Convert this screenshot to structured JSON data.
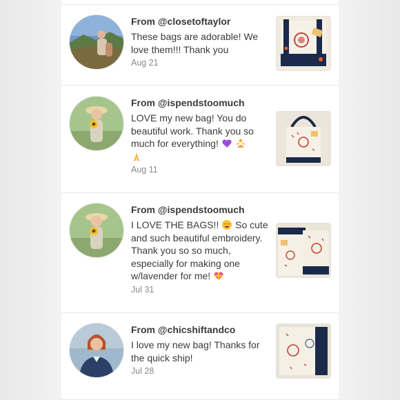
{
  "reviews": [
    {
      "from": "From @closetoftaylor",
      "message": "These bags are adorable! We love them!!! Thank you",
      "date": "Aug 21",
      "avatar_icon": "avatar-mountain-photo",
      "thumb_icon": "tote-bag-photo"
    },
    {
      "from": "From @ispendstoomuch",
      "message": "LOVE my new bag! You do beautiful work. Thank you so much for everything!",
      "emojis": [
        "purple-heart",
        "person-in-lotus",
        "folded-hands"
      ],
      "date": "Aug 11",
      "avatar_icon": "avatar-sunflower-photo",
      "thumb_icon": "tote-bag-photo"
    },
    {
      "from": "From @ispendstoomuch",
      "message_a": "I LOVE THE BAGS!!",
      "message_b": "So cute and such beautiful embroidery. Thank you so so much, especially for making one w/lavender for me!",
      "emojis": [
        "heart-eyes",
        "heart-with-ribbon"
      ],
      "date": "Jul 31",
      "avatar_icon": "avatar-sunflower-photo",
      "thumb_icon": "tote-bags-photo"
    },
    {
      "from": "From @chicshiftandco",
      "message": "I love my new bag! Thanks for the quick ship!",
      "date": "Jul 28",
      "avatar_icon": "avatar-portrait-photo",
      "thumb_icon": "tote-bag-photo"
    }
  ],
  "colors": {
    "accent_navy": "#1b2a4a",
    "canvas": "#f3ede0",
    "emblem_red": "#c2413b"
  }
}
